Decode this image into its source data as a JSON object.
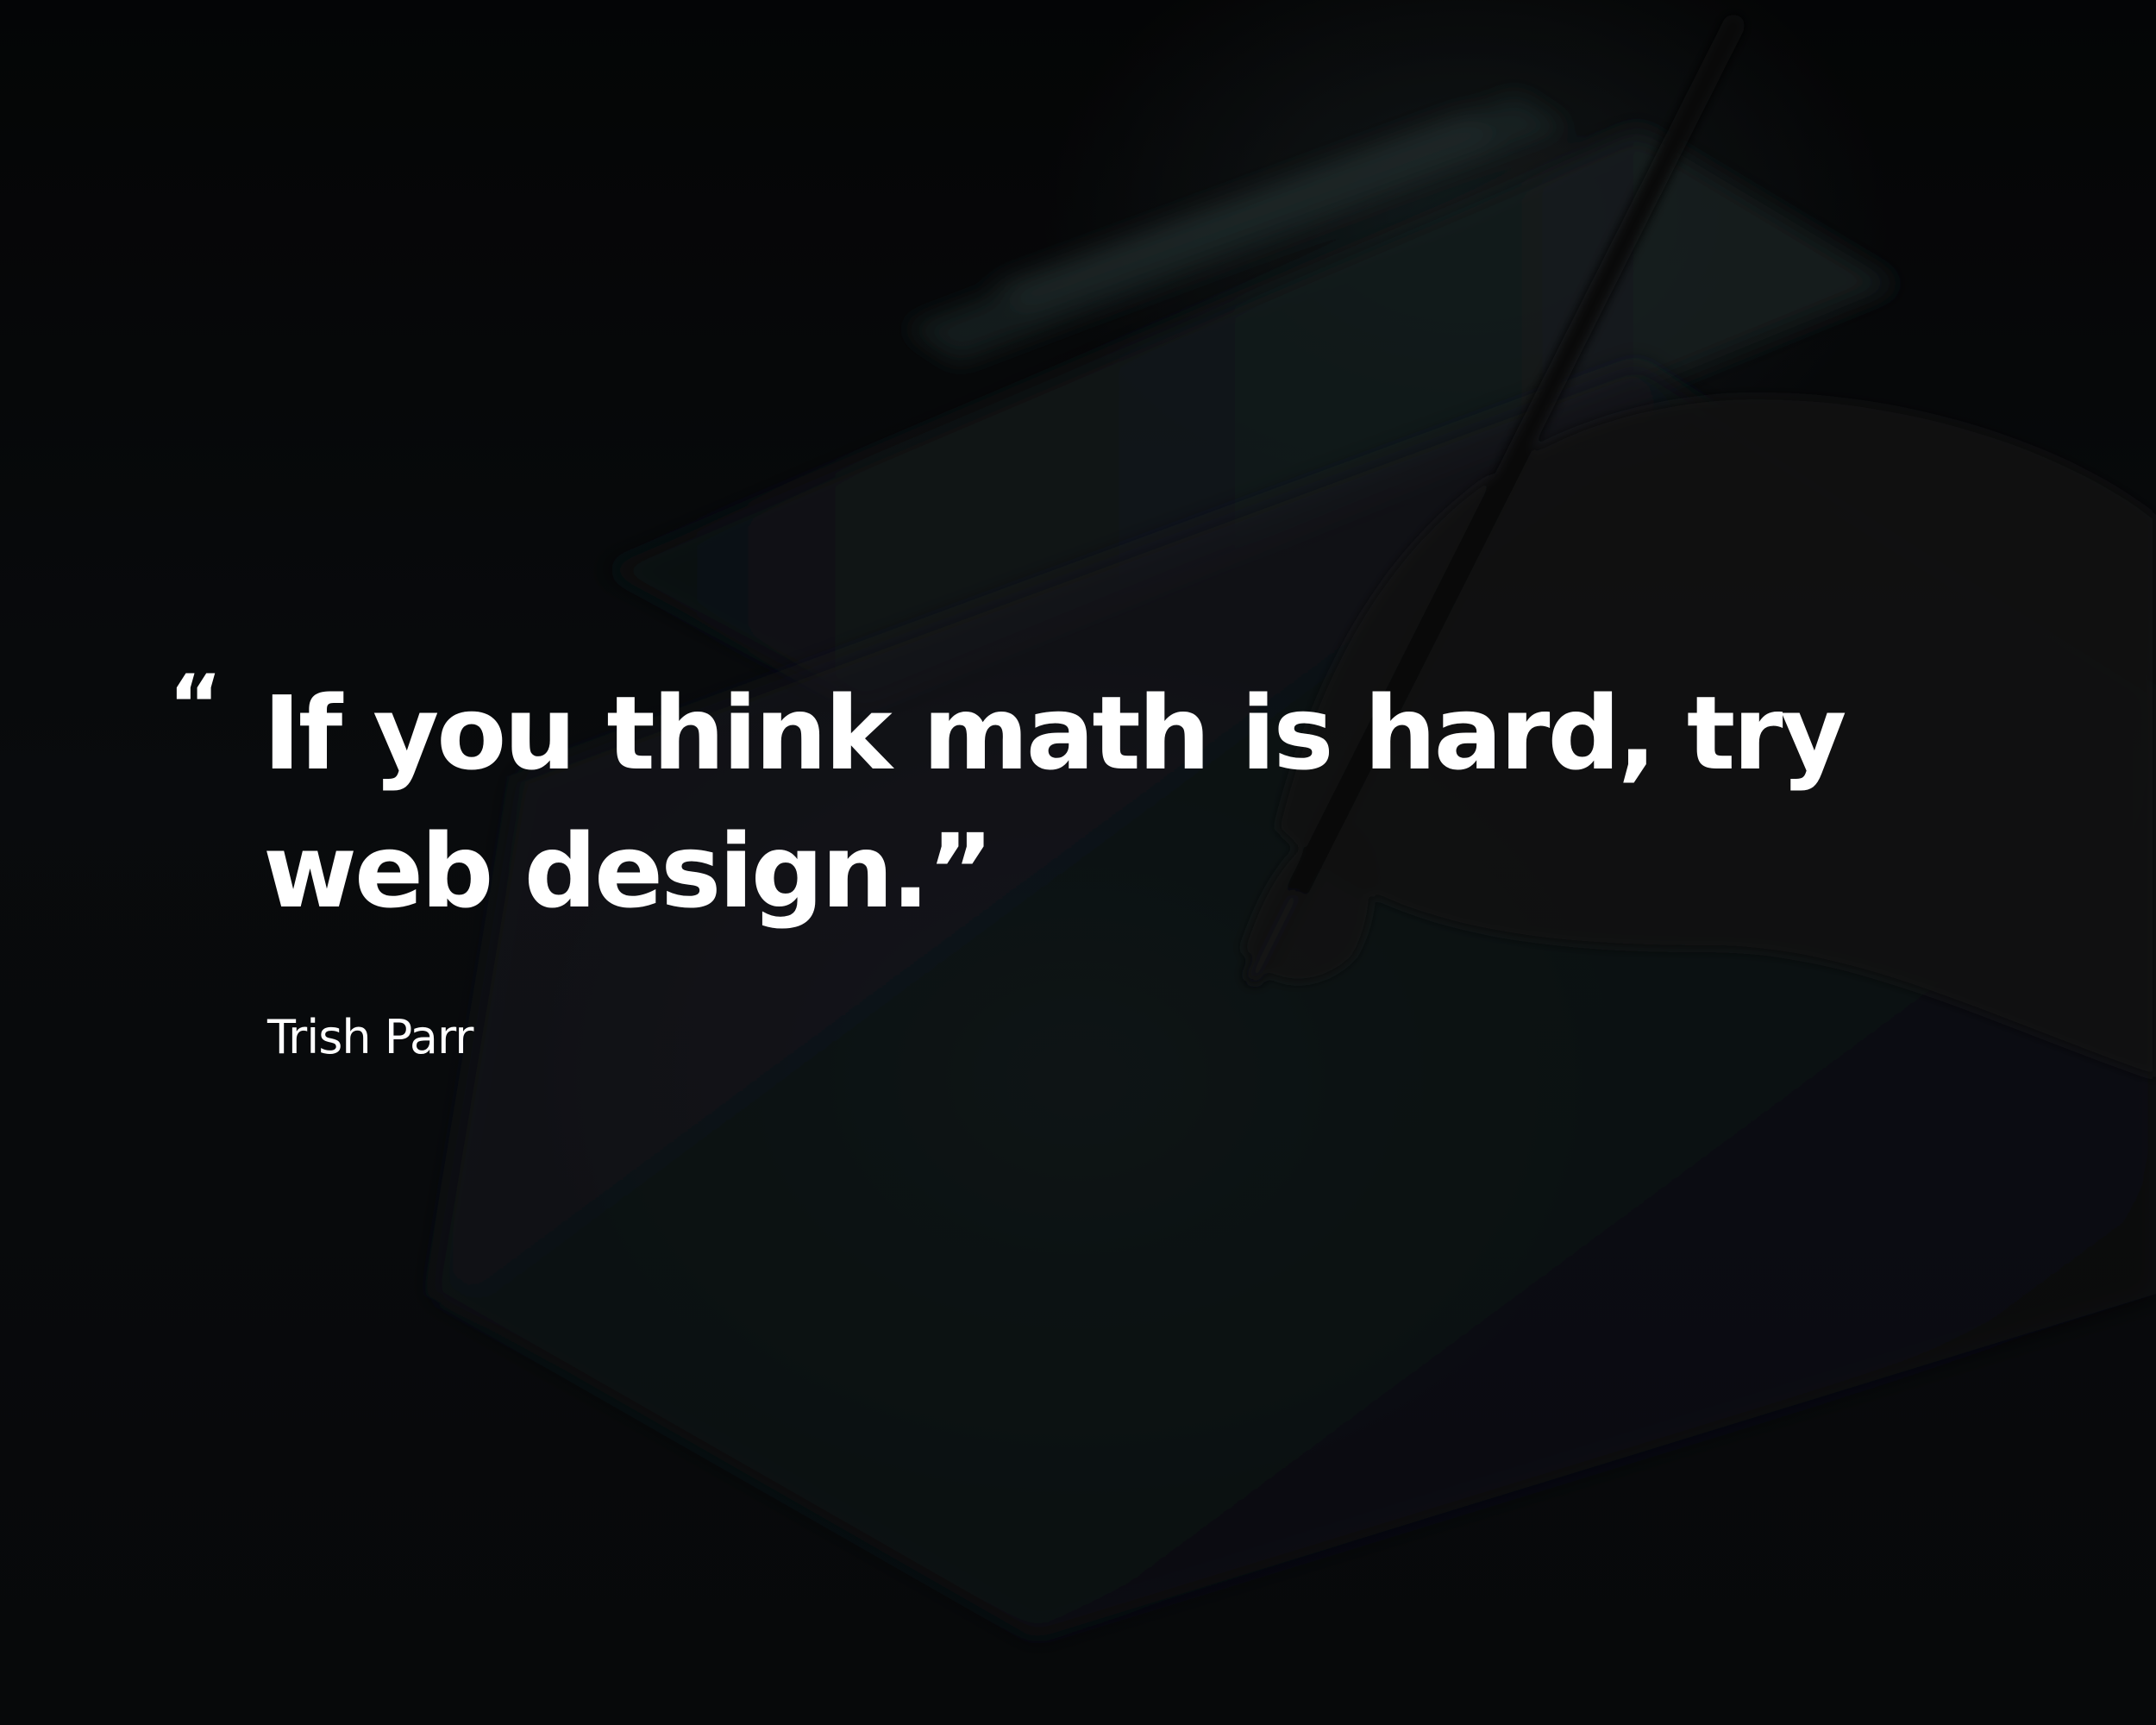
{
  "quote": {
    "open_mark": "“",
    "text": "If you think math is hard, try web design.”",
    "author": "Trish Parr"
  },
  "colors": {
    "background": "#0b0d0f",
    "text": "#ffffff"
  }
}
